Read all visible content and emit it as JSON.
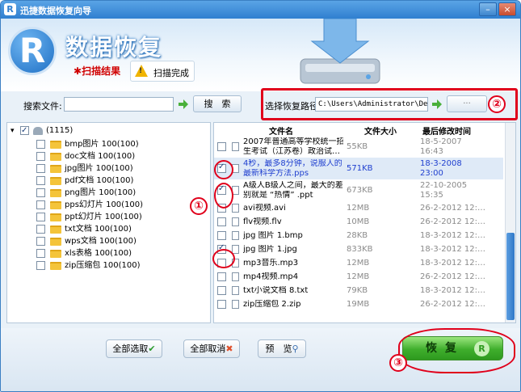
{
  "window": {
    "title": "迅捷数据恢复向导",
    "logo_letter": "R",
    "app_name": "数据恢复",
    "tabs": [
      {
        "label": "扫描结果",
        "marker": "✱"
      },
      {
        "label": "扫描完成"
      }
    ]
  },
  "search": {
    "label": "搜索文件:",
    "value": "",
    "button_label": "搜　索"
  },
  "recovery_path": {
    "label": "选择恢复路径",
    "value": "C:\\Users\\Administrator\\Desk",
    "browse_label": "···"
  },
  "tree": {
    "root": {
      "label": "(1115)",
      "checked": true
    },
    "items": [
      {
        "label": "bmp图片 100(100)"
      },
      {
        "label": "doc文档 100(100)"
      },
      {
        "label": "jpg图片 100(100)"
      },
      {
        "label": "pdf文档 100(100)"
      },
      {
        "label": "png图片 100(100)"
      },
      {
        "label": "pps幻灯片 100(100)"
      },
      {
        "label": "ppt幻灯片 100(100)"
      },
      {
        "label": "txt文档 100(100)"
      },
      {
        "label": "wps文档 100(100)"
      },
      {
        "label": "xls表格 100(100)"
      },
      {
        "label": "zip压缩包 100(100)"
      }
    ]
  },
  "files": {
    "columns": [
      "文件名",
      "文件大小",
      "最后修改时间"
    ],
    "rows": [
      {
        "name1": "2007年普通高等学校统一招",
        "name2": "生考试（江苏卷）政治试…",
        "size": "55KB",
        "date1": "18-5-2007",
        "date2": "16:43",
        "checked": false,
        "selected": false
      },
      {
        "name1": "4秒，最多8分钟，说服人的",
        "name2": "最新科学方法.pps",
        "size": "571KB",
        "date1": "18-3-2008",
        "date2": "23:00",
        "checked": true,
        "selected": true
      },
      {
        "name1": "A级人B级人之间，最大的差",
        "name2": "别就是 “热情” .ppt",
        "size": "673KB",
        "date1": "22-10-2005",
        "date2": "15:35",
        "checked": true,
        "selected": false
      },
      {
        "name1": "avi视频.avi",
        "size": "12MB",
        "date1": "26-2-2012 12:…",
        "checked": false,
        "selected": false
      },
      {
        "name1": "flv视频.flv",
        "size": "10MB",
        "date1": "26-2-2012 12:…",
        "checked": false,
        "selected": false
      },
      {
        "name1": "jpg 图片 1.bmp",
        "size": "28KB",
        "date1": "18-3-2012 12:…",
        "checked": false,
        "selected": false
      },
      {
        "name1": "jpg 图片 1.jpg",
        "size": "833KB",
        "date1": "18-3-2012 12:…",
        "checked": true,
        "selected": false
      },
      {
        "name1": "mp3音乐.mp3",
        "size": "12MB",
        "date1": "18-3-2012 12:…",
        "checked": false,
        "selected": false
      },
      {
        "name1": "mp4视频.mp4",
        "size": "12MB",
        "date1": "26-2-2012 12:…",
        "checked": false,
        "selected": false
      },
      {
        "name1": "txt小说文档 8.txt",
        "size": "79KB",
        "date1": "18-3-2012 12:…",
        "checked": false,
        "selected": false
      },
      {
        "name1": "zip压缩包 2.zip",
        "size": "19MB",
        "date1": "26-2-2012 12:…",
        "checked": false,
        "selected": false
      }
    ]
  },
  "buttons": {
    "select_all": "全部选取",
    "deselect_all": "全部取消",
    "preview": "预　览",
    "recover": "恢复"
  },
  "annotations": [
    "①",
    "②",
    "③"
  ],
  "colors": {
    "accent": "#2f7fd0",
    "annotation": "#e0001b",
    "recover_green": "#3fae2c",
    "selected_text": "#1f3fcf"
  }
}
